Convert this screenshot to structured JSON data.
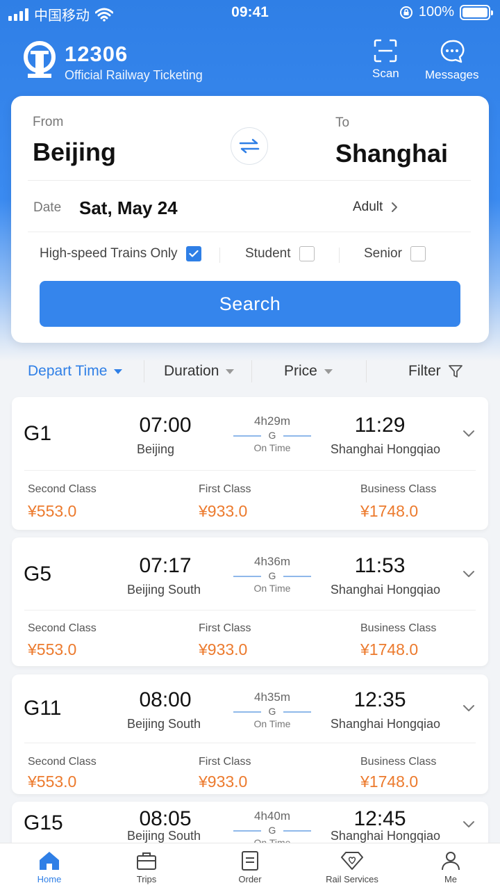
{
  "status_bar": {
    "carrier": "中国移动",
    "time": "09:41",
    "battery": "100%"
  },
  "header": {
    "title": "12306",
    "subtitle": "Official Railway Ticketing",
    "scan_label": "Scan",
    "messages_label": "Messages"
  },
  "search": {
    "from_label": "From",
    "from_city": "Beijing",
    "to_label": "To",
    "to_city": "Shanghai",
    "date_label": "Date",
    "date_value": "Sat, May 24",
    "passenger_type": "Adult",
    "options": [
      {
        "label": "High-speed Trains Only",
        "checked": true
      },
      {
        "label": "Student",
        "checked": false
      },
      {
        "label": "Senior",
        "checked": false
      }
    ],
    "search_button": "Search"
  },
  "sort": {
    "depart_time": "Depart Time",
    "duration": "Duration",
    "price": "Price",
    "filter": "Filter"
  },
  "trains": [
    {
      "number": "G1",
      "depart_time": "07:00",
      "depart_station": "Beijing",
      "duration": "4h29m",
      "type": "G",
      "status": "On Time",
      "arrive_time": "11:29",
      "arrive_station": "Shanghai Hongqiao",
      "classes": [
        {
          "name": "Second Class",
          "price": "¥553.0"
        },
        {
          "name": "First Class",
          "price": "¥933.0"
        },
        {
          "name": "Business Class",
          "price": "¥1748.0"
        }
      ]
    },
    {
      "number": "G5",
      "depart_time": "07:17",
      "depart_station": "Beijing South",
      "duration": "4h36m",
      "type": "G",
      "status": "On Time",
      "arrive_time": "11:53",
      "arrive_station": "Shanghai Hongqiao",
      "classes": [
        {
          "name": "Second Class",
          "price": "¥553.0"
        },
        {
          "name": "First Class",
          "price": "¥933.0"
        },
        {
          "name": "Business Class",
          "price": "¥1748.0"
        }
      ]
    },
    {
      "number": "G11",
      "depart_time": "08:00",
      "depart_station": "Beijing South",
      "duration": "4h35m",
      "type": "G",
      "status": "On Time",
      "arrive_time": "12:35",
      "arrive_station": "Shanghai Hongqiao",
      "classes": [
        {
          "name": "Second Class",
          "price": "¥553.0"
        },
        {
          "name": "First Class",
          "price": "¥933.0"
        },
        {
          "name": "Business Class",
          "price": "¥1748.0"
        }
      ]
    },
    {
      "number": "G15",
      "depart_time": "08:05",
      "depart_station": "Beijing South",
      "duration": "4h40m",
      "type": "G",
      "status": "On Time",
      "arrive_time": "12:45",
      "arrive_station": "Shanghai Hongqiao"
    }
  ],
  "nav": {
    "home": "Home",
    "trips": "Trips",
    "order": "Order",
    "rail_services": "Rail Services",
    "me": "Me"
  },
  "colors": {
    "primary": "#2f7fe6",
    "price": "#ec7a2d"
  }
}
